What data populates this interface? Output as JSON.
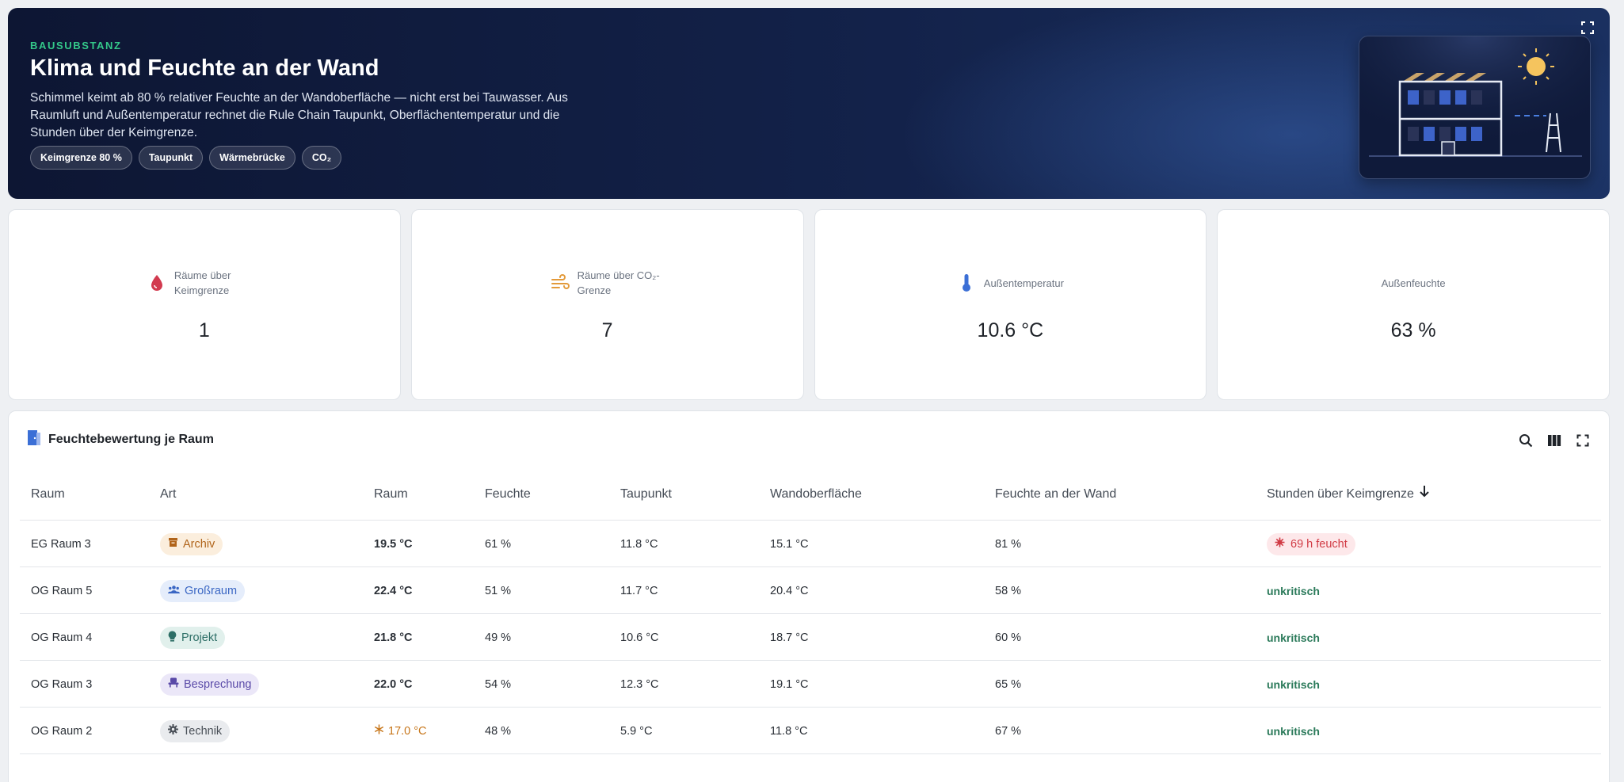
{
  "hero": {
    "eyebrow": "BAUSUBSTANZ",
    "title": "Klima und Feuchte an der Wand",
    "description": "Schimmel keimt ab 80 % relativer Feuchte an der Wandoberfläche — nicht erst bei Tauwasser. Aus Raumluft und Außentemperatur rechnet die Rule Chain Taupunkt, Oberflächentemperatur und die Stunden über der Keimgrenze.",
    "chips": [
      "Keimgrenze 80 %",
      "Taupunkt",
      "Wärmebrücke",
      "CO₂"
    ],
    "fullscreen_icon": "fullscreen-icon",
    "illustration_icon": "building-sun-illustration"
  },
  "kpis": [
    {
      "label": "Räume über Keimgrenze",
      "value": "1",
      "icon": "droplet-icon",
      "color": "#d23a4f"
    },
    {
      "label": "Räume über CO₂-Grenze",
      "value": "7",
      "icon": "wind-icon",
      "color": "#e39a3a"
    },
    {
      "label": "Außentemperatur",
      "value": "10.6 °C",
      "icon": "thermometer-icon",
      "color": "#3b6fd6"
    },
    {
      "label": "Außenfeuchte",
      "value": "63 %",
      "icon": "",
      "color": ""
    }
  ],
  "table": {
    "title": "Feuchtebewertung je Raum",
    "title_icon": "door-icon",
    "tools": [
      "search-icon",
      "columns-icon",
      "fullscreen-icon"
    ],
    "sort_icon": "arrow-down-icon",
    "columns": [
      "Raum",
      "Art",
      "Raum",
      "Feuchte",
      "Taupunkt",
      "Wandoberfläche",
      "Feuchte an der Wand",
      "Stunden über Keimgrenze"
    ],
    "rows": [
      {
        "room": "EG Raum 3",
        "type": "Archiv",
        "type_icon": "archive-icon",
        "type_color": "#b0641a",
        "type_bg": "#fbeedd",
        "temp": "19.5 °C",
        "temp_warn": false,
        "humidity": "61 %",
        "dewpoint": "11.8 °C",
        "wall": "15.1 °C",
        "wall_humidity": "81 %",
        "status": "69 h feucht",
        "status_critical": true
      },
      {
        "room": "OG Raum 5",
        "type": "Großraum",
        "type_icon": "group-icon",
        "type_color": "#3b67c4",
        "type_bg": "#e5edfb",
        "temp": "22.4 °C",
        "temp_warn": false,
        "humidity": "51 %",
        "dewpoint": "11.7 °C",
        "wall": "20.4 °C",
        "wall_humidity": "58 %",
        "status": "unkritisch",
        "status_critical": false
      },
      {
        "room": "OG Raum 4",
        "type": "Projekt",
        "type_icon": "lightbulb-icon",
        "type_color": "#2d6e66",
        "type_bg": "#e1f0ec",
        "temp": "21.8 °C",
        "temp_warn": false,
        "humidity": "49 %",
        "dewpoint": "10.6 °C",
        "wall": "18.7 °C",
        "wall_humidity": "60 %",
        "status": "unkritisch",
        "status_critical": false
      },
      {
        "room": "OG Raum 3",
        "type": "Besprechung",
        "type_icon": "meeting-icon",
        "type_color": "#5a4aa8",
        "type_bg": "#ebe7f8",
        "temp": "22.0 °C",
        "temp_warn": false,
        "humidity": "54 %",
        "dewpoint": "12.3 °C",
        "wall": "19.1 °C",
        "wall_humidity": "65 %",
        "status": "unkritisch",
        "status_critical": false
      },
      {
        "room": "OG Raum 2",
        "type": "Technik",
        "type_icon": "gear-icon",
        "type_color": "#4a5058",
        "type_bg": "#e9ebee",
        "temp": "17.0 °C",
        "temp_warn": true,
        "humidity": "48 %",
        "dewpoint": "5.9 °C",
        "wall": "11.8 °C",
        "wall_humidity": "67 %",
        "status": "unkritisch",
        "status_critical": false
      }
    ]
  }
}
